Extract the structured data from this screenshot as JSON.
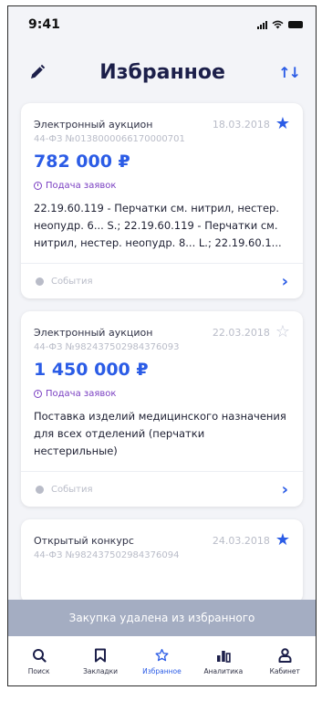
{
  "status_bar": {
    "time": "9:41"
  },
  "header": {
    "title": "Избранное"
  },
  "cards": [
    {
      "type": "Электронный аукцион",
      "date": "18.03.2018",
      "number": "44-ФЗ  №0138000066170000701",
      "price": "782 000 ₽",
      "status": "Подача заявок",
      "description": "22.19.60.119 - Перчатки см. нитрил, нестер. неопудр. 6... S.; 22.19.60.119 - Перчатки см. нитрил, нестер. неопудр. 8... L.; 22.19.60.1...",
      "events_label": "События",
      "favorite": true
    },
    {
      "type": "Электронный аукцион",
      "date": "22.03.2018",
      "number": "44-ФЗ  №982437502984376093",
      "price": "1 450 000 ₽",
      "status": "Подача заявок",
      "description": "Поставка изделий медицинского назначения для всех отделений (перчатки нестерильные)",
      "events_label": "События",
      "favorite": false
    },
    {
      "type": "Открытый конкурс",
      "date": "24.03.2018",
      "number": "44-ФЗ  №982437502984376094",
      "favorite": true
    }
  ],
  "toast": {
    "text": "Закупка удалена из избранного"
  },
  "tabbar": {
    "items": [
      {
        "label": "Поиск",
        "icon": "search-icon"
      },
      {
        "label": "Закладки",
        "icon": "bookmark-icon"
      },
      {
        "label": "Избранное",
        "icon": "star-icon"
      },
      {
        "label": "Аналитика",
        "icon": "chart-icon"
      },
      {
        "label": "Кабинет",
        "icon": "user-icon"
      }
    ],
    "active": "Избранное"
  },
  "colors": {
    "accent": "#2b5ce6",
    "status": "#7a3fc2",
    "toast_bg": "#a4adc2"
  }
}
